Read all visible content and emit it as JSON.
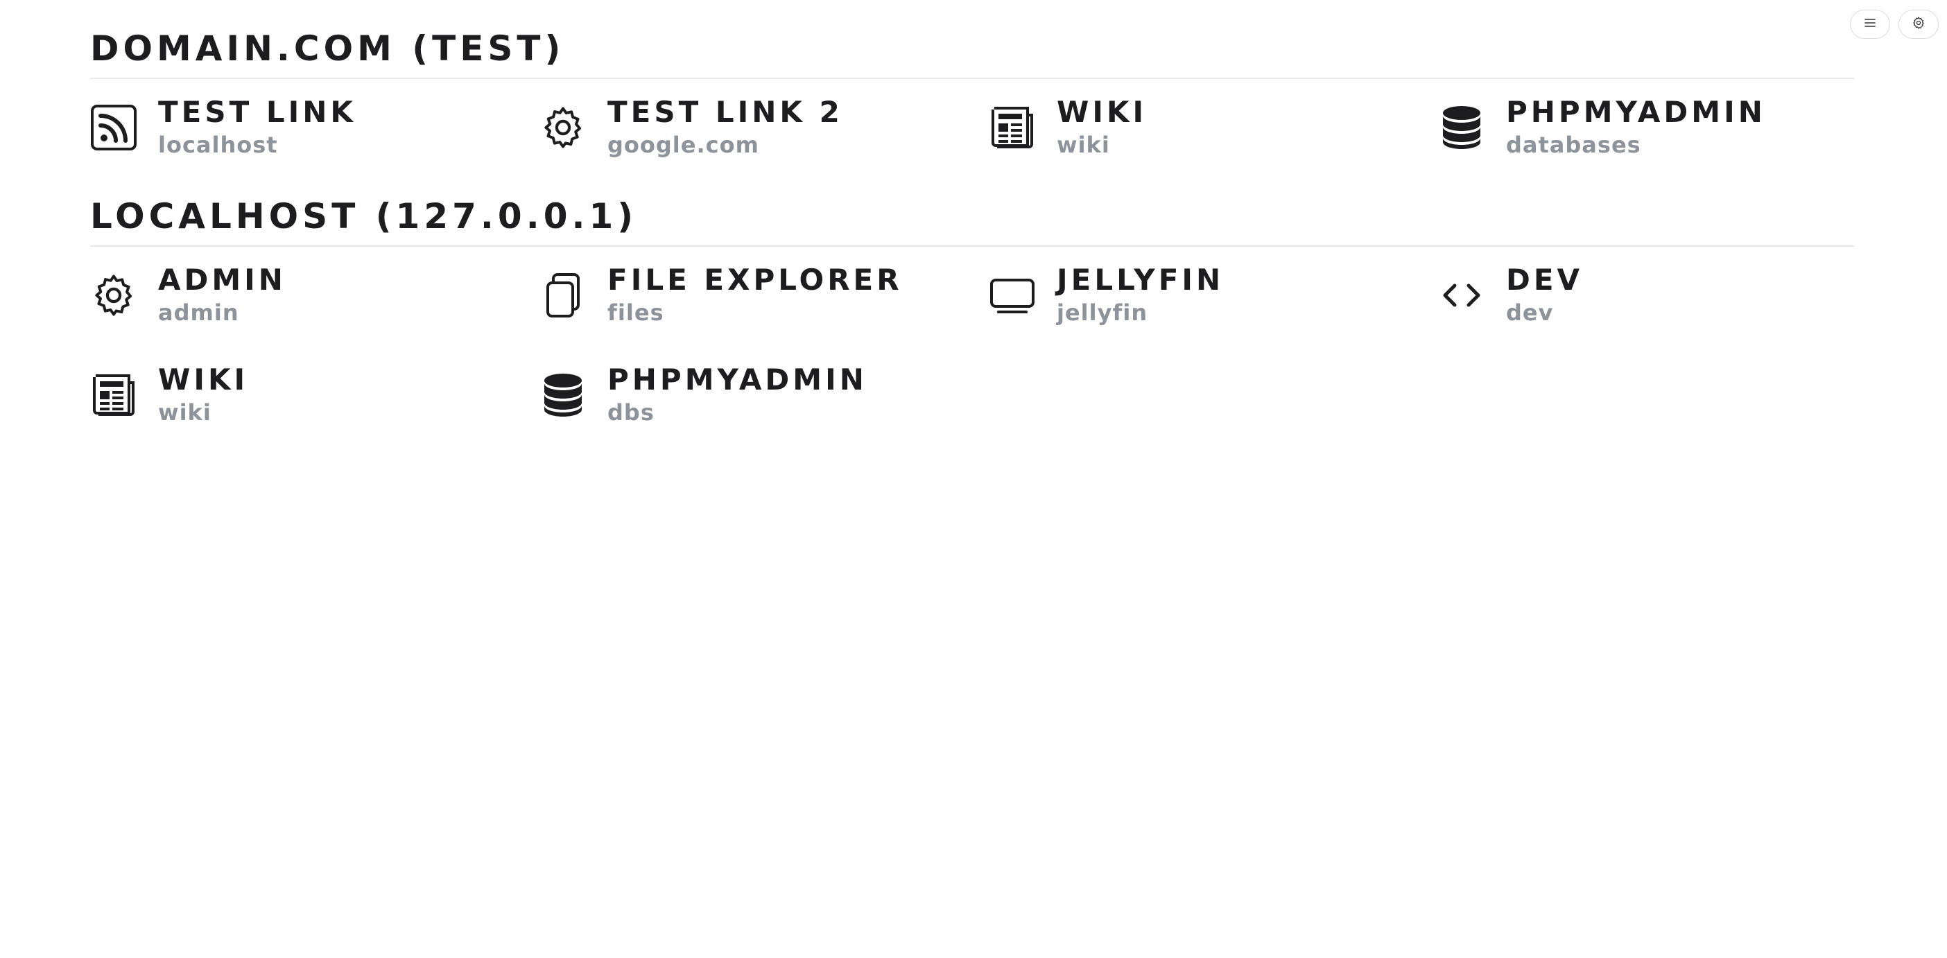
{
  "toolbar": {
    "menu_icon": "menu-icon",
    "settings_icon": "gear-icon"
  },
  "groups": [
    {
      "title": "DOMAIN.COM (TEST)",
      "apps": [
        {
          "name": "TEST LINK",
          "url": "localhost",
          "icon": "rss-icon"
        },
        {
          "name": "TEST LINK 2",
          "url": "google.com",
          "icon": "gear-icon"
        },
        {
          "name": "WIKI",
          "url": "wiki",
          "icon": "newspaper-icon"
        },
        {
          "name": "PHPMYADMIN",
          "url": "databases",
          "icon": "database-icon"
        }
      ]
    },
    {
      "title": "LOCALHOST (127.0.0.1)",
      "apps": [
        {
          "name": "ADMIN",
          "url": "admin",
          "icon": "gear-icon"
        },
        {
          "name": "FILE EXPLORER",
          "url": "files",
          "icon": "files-icon"
        },
        {
          "name": "JELLYFIN",
          "url": "jellyfin",
          "icon": "tv-icon"
        },
        {
          "name": "DEV",
          "url": "dev",
          "icon": "code-icon"
        },
        {
          "name": "WIKI",
          "url": "wiki",
          "icon": "newspaper-icon"
        },
        {
          "name": "PHPMYADMIN",
          "url": "dbs",
          "icon": "database-icon"
        }
      ]
    }
  ]
}
